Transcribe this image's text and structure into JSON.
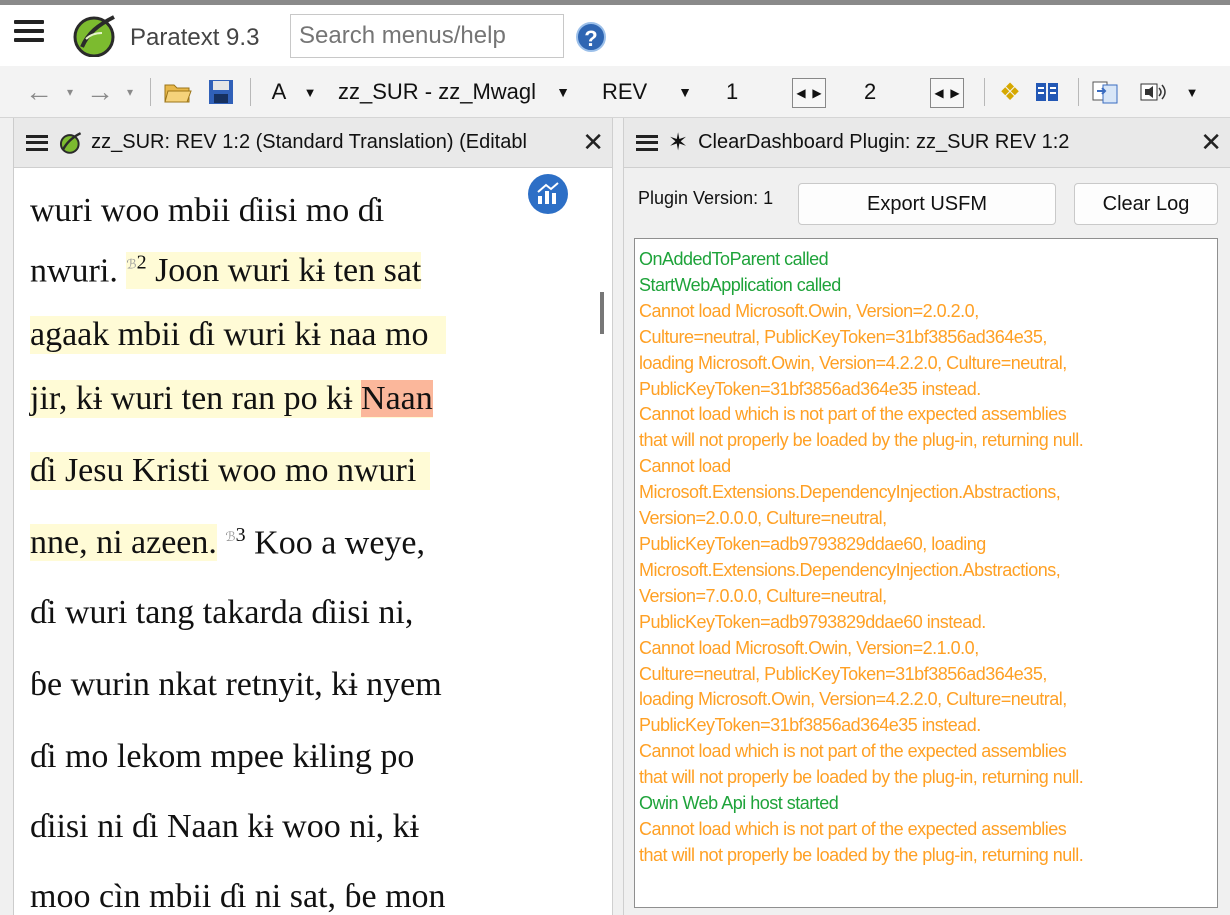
{
  "app": {
    "title": "Paratext 9.3"
  },
  "search": {
    "placeholder": "Search menus/help"
  },
  "toolbar": {
    "font_button": "A",
    "project": "zz_SUR - zz_Mwagl",
    "book": "REV",
    "chapter": "1",
    "verse": "2"
  },
  "left_pane": {
    "title": "zz_SUR: REV 1:2 (Standard Translation) (Editabl",
    "verse2_number": "2",
    "verse3_number": "3",
    "lines": {
      "l1": "wuri woo mbii ɗiisi mo ɗi",
      "l2a": "nwuri.",
      "l2b": "Joon wuri kɨ ten sat",
      "l3": "agaak mbii ɗi wuri kɨ naa mo",
      "l4a": "jir, kɨ wuri ten ran po kɨ",
      "l4b": "Naan",
      "l5": " ɗi Jesu Kristi woo mo nwuri",
      "l6a": "nne, ni azeen.",
      "l6b": "Koo a weye,",
      "l7": "ɗi wuri tang takarda ɗiisi ni,",
      "l8": "ɓe wurin nkat retnyit, kɨ nyem",
      "l9": "ɗi mo lekom mpee kɨling po",
      "l10": "ɗiisi ni ɗi Naan kɨ woo ni, kɨ",
      "l11": "moo cìn mbii ɗi ni sat, ɓe mon"
    }
  },
  "right_pane": {
    "title": "ClearDashboard Plugin: zz_SUR REV 1:2",
    "plugin_version_label": "Plugin Version: 1",
    "export_button": "Export USFM",
    "clear_button": "Clear Log",
    "log": [
      {
        "text": "OnAddedToParent called",
        "level": "info"
      },
      {
        "text": "StartWebApplication called",
        "level": "info"
      },
      {
        "text": "Cannot load Microsoft.Owin, Version=2.0.2.0,",
        "level": "warn"
      },
      {
        "text": "Culture=neutral, PublicKeyToken=31bf3856ad364e35,",
        "level": "warn"
      },
      {
        "text": "loading Microsoft.Owin, Version=4.2.2.0, Culture=neutral,",
        "level": "warn"
      },
      {
        "text": "PublicKeyToken=31bf3856ad364e35 instead.",
        "level": "warn"
      },
      {
        "text": "Cannot load  which is not part of the expected assemblies",
        "level": "warn"
      },
      {
        "text": "that will not properly be loaded by the plug-in, returning null.",
        "level": "warn"
      },
      {
        "text": "Cannot load",
        "level": "warn"
      },
      {
        "text": "Microsoft.Extensions.DependencyInjection.Abstractions,",
        "level": "warn"
      },
      {
        "text": "Version=2.0.0.0, Culture=neutral,",
        "level": "warn"
      },
      {
        "text": "PublicKeyToken=adb9793829ddae60, loading",
        "level": "warn"
      },
      {
        "text": "Microsoft.Extensions.DependencyInjection.Abstractions,",
        "level": "warn"
      },
      {
        "text": "Version=7.0.0.0, Culture=neutral,",
        "level": "warn"
      },
      {
        "text": "PublicKeyToken=adb9793829ddae60 instead.",
        "level": "warn"
      },
      {
        "text": "Cannot load Microsoft.Owin, Version=2.1.0.0,",
        "level": "warn"
      },
      {
        "text": "Culture=neutral, PublicKeyToken=31bf3856ad364e35,",
        "level": "warn"
      },
      {
        "text": "loading Microsoft.Owin, Version=4.2.2.0, Culture=neutral,",
        "level": "warn"
      },
      {
        "text": "PublicKeyToken=31bf3856ad364e35 instead.",
        "level": "warn"
      },
      {
        "text": "Cannot load  which is not part of the expected assemblies",
        "level": "warn"
      },
      {
        "text": "that will not properly be loaded by the plug-in, returning null.",
        "level": "warn"
      },
      {
        "text": "Owin Web Api host started",
        "level": "info"
      },
      {
        "text": "Cannot load  which is not part of the expected assemblies",
        "level": "warn"
      },
      {
        "text": "that will not properly be loaded by the plug-in, returning null.",
        "level": "warn"
      }
    ]
  },
  "colors": {
    "info": "#1ea33a",
    "warn": "#ffa024",
    "highlight": "#fffbd6",
    "selection": "#fbb79b"
  }
}
